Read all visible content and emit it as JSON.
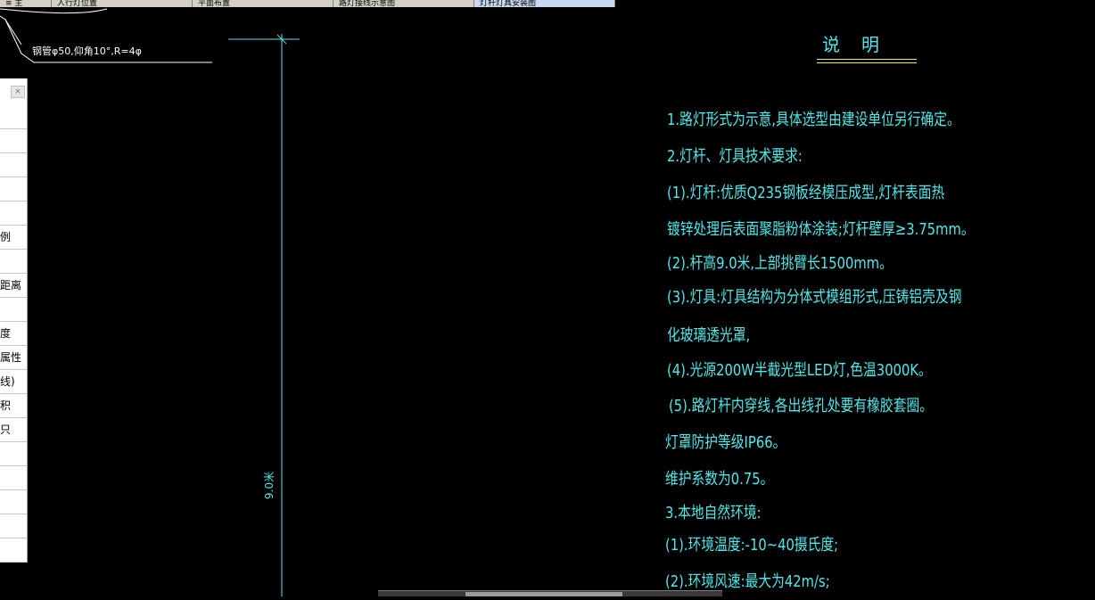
{
  "tabs": [
    {
      "label": "≡ 主"
    },
    {
      "label": "人行灯位置"
    },
    {
      "label": "平面布置"
    },
    {
      "label": "路灯接线示意图"
    },
    {
      "label": "灯杆灯具安装图"
    }
  ],
  "colors": {
    "background": "#000000",
    "cad_text": "#4fe8ec",
    "underline": "#f0f000",
    "line": "#ffffff",
    "dimension": "#4fe8ec"
  },
  "cad": {
    "callout_label": "钢管φ50,仰角10°,R=4φ",
    "dimension_label": "9.0米"
  },
  "panel": {
    "close_label": "×",
    "rows": [
      "",
      "",
      "",
      "",
      "",
      "例",
      "",
      "距离",
      "",
      "度",
      "属性",
      "线)",
      "积",
      "只",
      "",
      "",
      "",
      "",
      ""
    ]
  },
  "notes": {
    "title": "说明",
    "lines": [
      "1.路灯形式为示意,具体选型由建设单位另行确定。",
      "2.灯杆、灯具技术要求:",
      "(1).灯杆:优质Q235钢板经模压成型,灯杆表面热",
      "镀锌处理后表面聚脂粉体涂装;灯杆壁厚≥3.75mm。",
      "(2).杆高9.0米,上部挑臂长1500mm。",
      "(3).灯具:灯具结构为分体式模组形式,压铸铝壳及钢",
      "化玻璃透光罩,",
      "(4).光源200W半截光型LED灯,色温3000K。",
      "(5).路灯杆内穿线,各出线孔处要有橡胶套圈。",
      "灯罩防护等级IP66。",
      "维护系数为0.75。",
      "3.本地自然环境:",
      "(1).环境温度:-10~40摄氏度;",
      "(2).环境风速:最大为42m/s;"
    ]
  }
}
